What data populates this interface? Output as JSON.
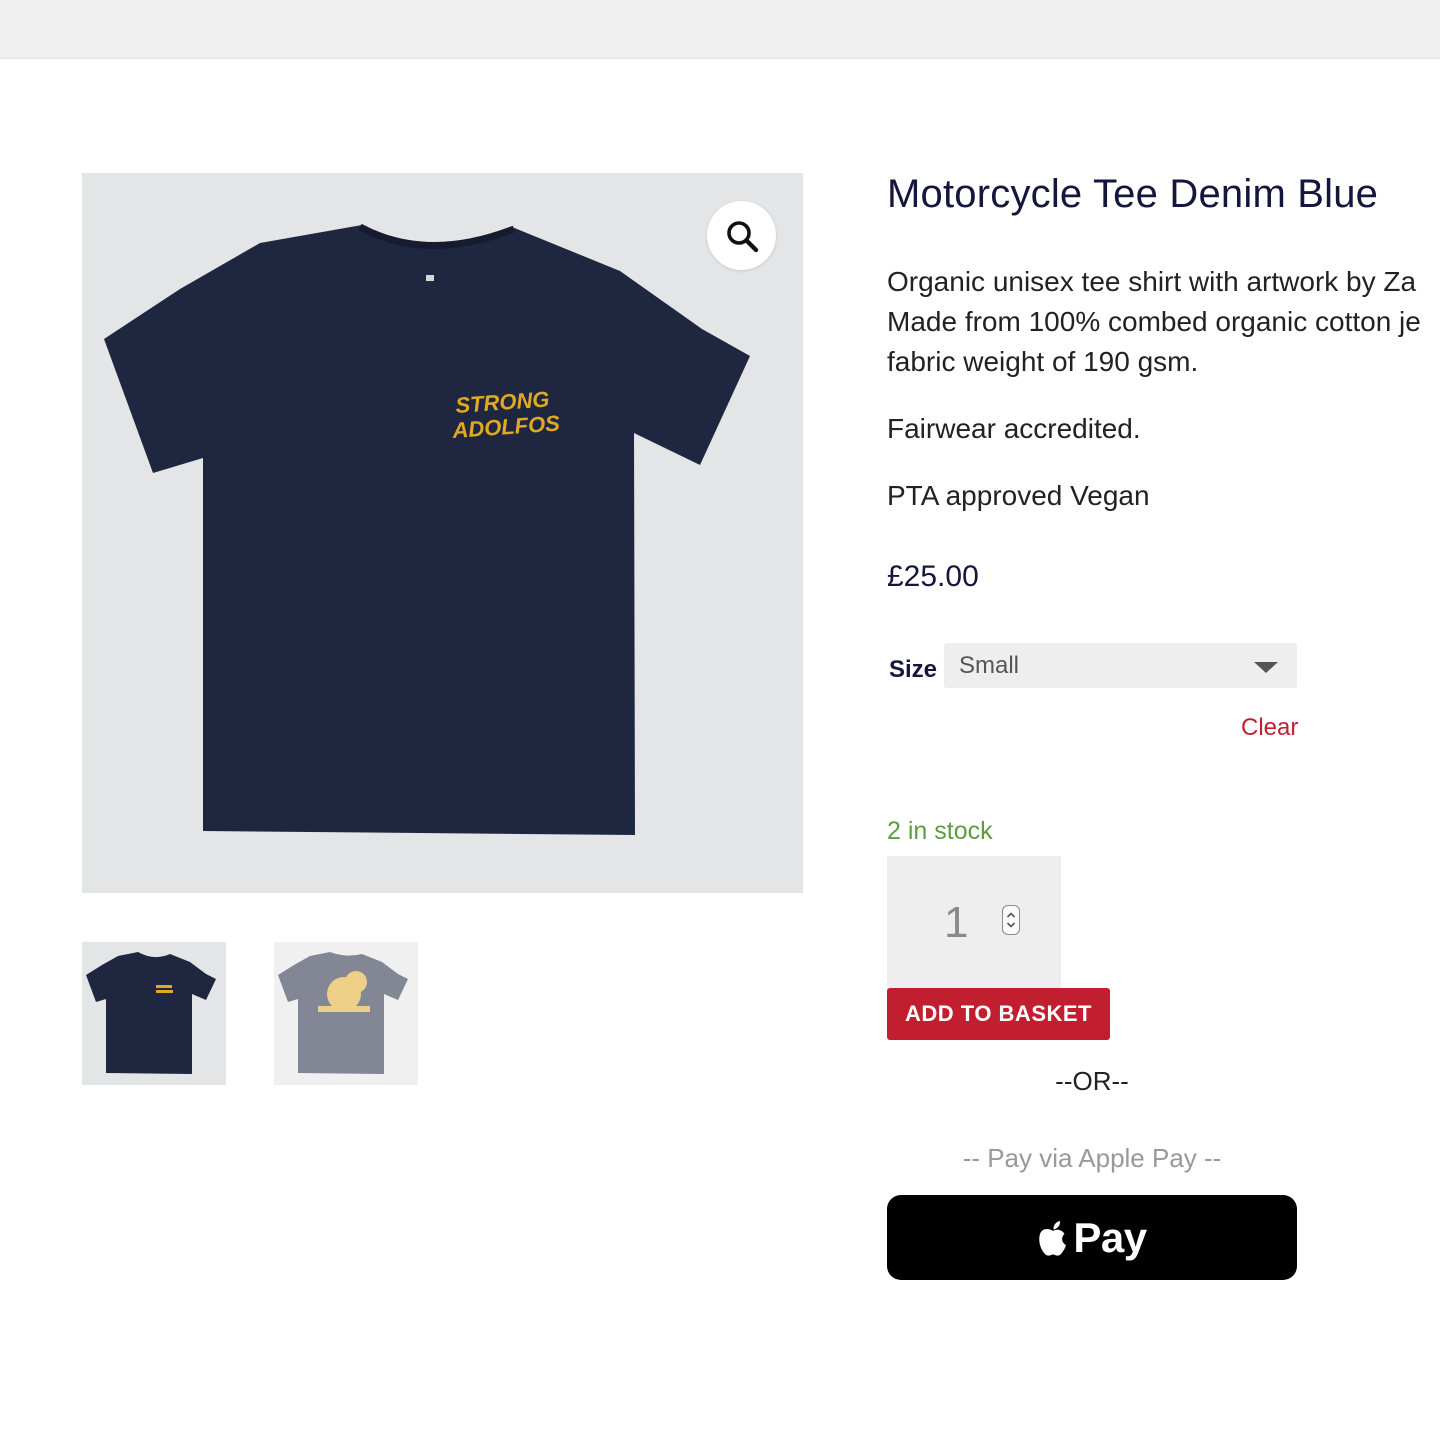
{
  "product": {
    "title": "Motorcycle Tee Denim Blue",
    "description": [
      "Organic unisex tee shirt with artwork by Za",
      "Made from 100% combed organic cotton je",
      "fabric weight of 190 gsm.",
      "Fairwear accredited.",
      "PTA approved Vegan"
    ],
    "price": "£25.00",
    "artwork_text": [
      "STRONG",
      "ADOLFOS"
    ]
  },
  "variation": {
    "size_label": "Size",
    "size_value": "Small",
    "clear_label": "Clear"
  },
  "stock": {
    "status": "2 in stock"
  },
  "quantity": {
    "value": "1"
  },
  "actions": {
    "add_to_basket": "ADD TO BASKET",
    "or_label": "--OR--",
    "applepay_note": "-- Pay via Apple Pay --",
    "applepay_label": "Pay"
  },
  "gallery": {
    "zoom_icon": "magnifier-icon",
    "thumbnails": [
      "thumbnail-front",
      "thumbnail-back"
    ]
  },
  "colors": {
    "brand_red": "#c11f30",
    "title_navy": "#15163d",
    "stock_green": "#5b9e42",
    "shirt_navy": "#1f2640",
    "print_yellow": "#e1a824"
  }
}
